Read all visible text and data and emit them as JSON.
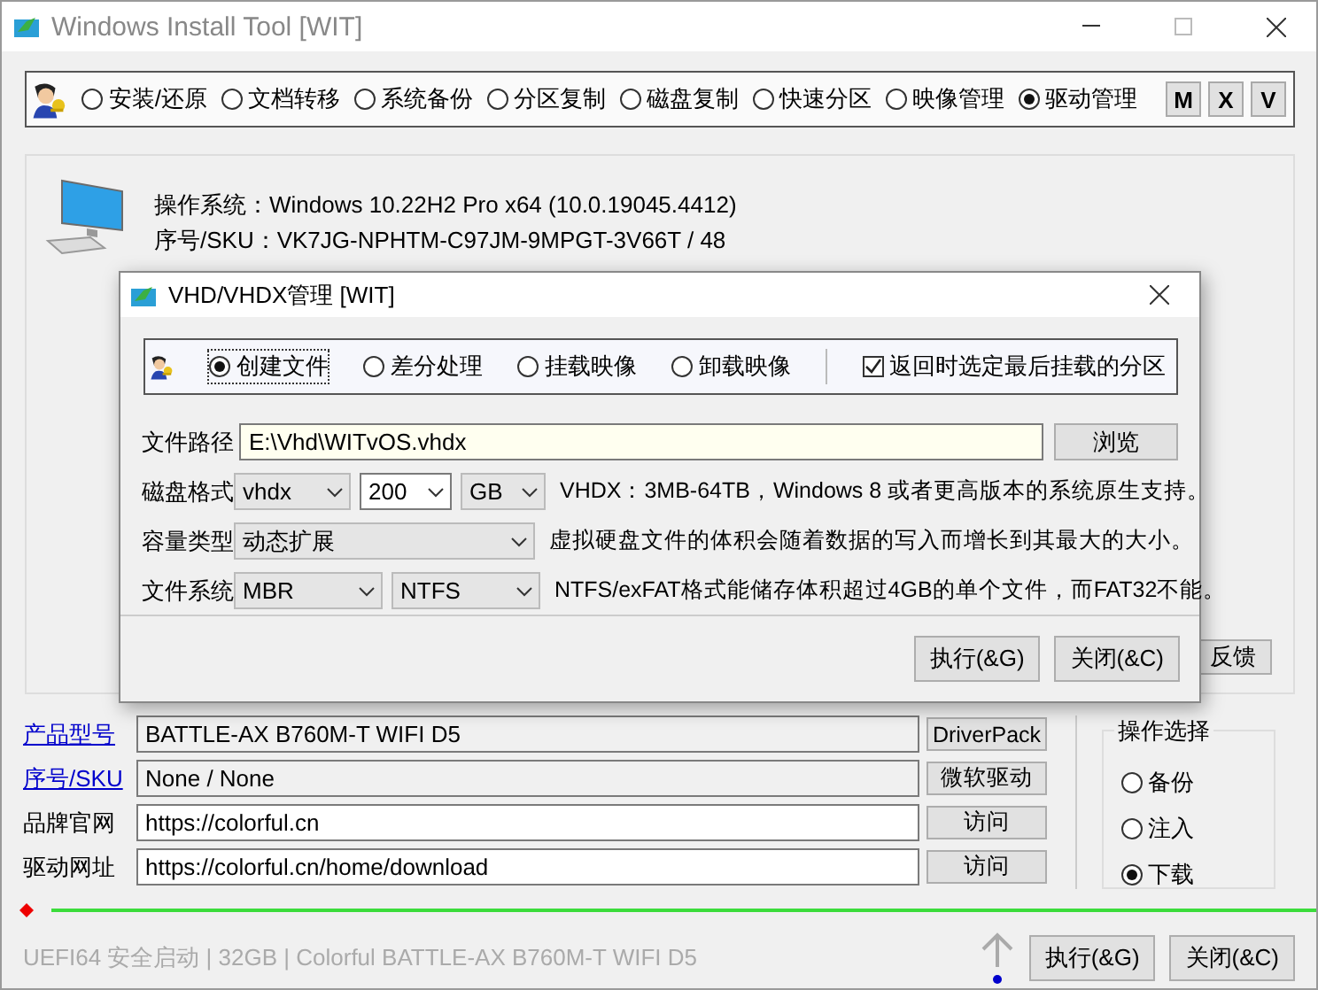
{
  "window": {
    "title": "Windows Install Tool [WIT]"
  },
  "toolbar": {
    "modes": [
      {
        "label": "安装/还原",
        "selected": false
      },
      {
        "label": "文档转移",
        "selected": false
      },
      {
        "label": "系统备份",
        "selected": false
      },
      {
        "label": "分区复制",
        "selected": false
      },
      {
        "label": "磁盘复制",
        "selected": false
      },
      {
        "label": "快速分区",
        "selected": false
      },
      {
        "label": "映像管理",
        "selected": false
      },
      {
        "label": "驱动管理",
        "selected": true
      }
    ],
    "buttons": [
      "M",
      "X",
      "V"
    ]
  },
  "system_info": {
    "lines": [
      "操作系统：Windows 10.22H2 Pro x64 (10.0.19045.4412)",
      "序号/SKU：VK7JG-NPHTM-C97JM-9MPGT-3V66T / 48"
    ],
    "feedback_button": "反馈"
  },
  "device": {
    "rows": [
      {
        "kind": "link",
        "label": "产品型号",
        "value": "BATTLE-AX B760M-T WIFI D5",
        "readonly": true,
        "button": "DriverPack"
      },
      {
        "kind": "link",
        "label": "序号/SKU",
        "value": "None / None",
        "readonly": true,
        "button": "微软驱动"
      },
      {
        "kind": "text",
        "label": "品牌官网",
        "value": "https://colorful.cn",
        "readonly": false,
        "button": "访问"
      },
      {
        "kind": "text",
        "label": "驱动网址",
        "value": "https://colorful.cn/home/download",
        "readonly": false,
        "button": "访问"
      }
    ]
  },
  "operation": {
    "title": "操作选择",
    "options": [
      {
        "label": "备份",
        "selected": false
      },
      {
        "label": "注入",
        "selected": false
      },
      {
        "label": "下载",
        "selected": true
      }
    ]
  },
  "status_bar": {
    "text": "UEFI64 安全启动 | 32GB | Colorful BATTLE-AX B760M-T WIFI D5",
    "buttons": [
      "执行(&G)",
      "关闭(&C)"
    ]
  },
  "dialog": {
    "title": "VHD/VHDX管理 [WIT]",
    "modes": [
      {
        "label": "创建文件",
        "selected": true
      },
      {
        "label": "差分处理",
        "selected": false
      },
      {
        "label": "挂载映像",
        "selected": false
      },
      {
        "label": "卸载映像",
        "selected": false
      }
    ],
    "checkbox": {
      "label": "返回时选定最后挂载的分区",
      "checked": true
    },
    "path": {
      "label": "文件路径",
      "value": "E:\\Vhd\\WITvOS.vhdx",
      "button": "浏览"
    },
    "rows": [
      {
        "label": "磁盘格式",
        "selects": [
          {
            "value": "vhdx",
            "editable": false
          },
          {
            "value": "200",
            "editable": true
          },
          {
            "value": "GB",
            "editable": false
          }
        ],
        "note": "VHDX：3MB-64TB，Windows 8 或者更高版本的系统原生支持。"
      },
      {
        "label": "容量类型",
        "selects": [
          {
            "value": "动态扩展",
            "editable": false
          }
        ],
        "note": "虚拟硬盘文件的体积会随着数据的写入而增长到其最大的大小。"
      },
      {
        "label": "文件系统",
        "selects": [
          {
            "value": "MBR",
            "editable": false
          },
          {
            "value": "NTFS",
            "editable": false
          }
        ],
        "note": "NTFS/exFAT格式能储存体积超过4GB的单个文件，而FAT32不能。"
      }
    ],
    "buttons": [
      "执行(&G)",
      "关闭(&C)"
    ]
  }
}
